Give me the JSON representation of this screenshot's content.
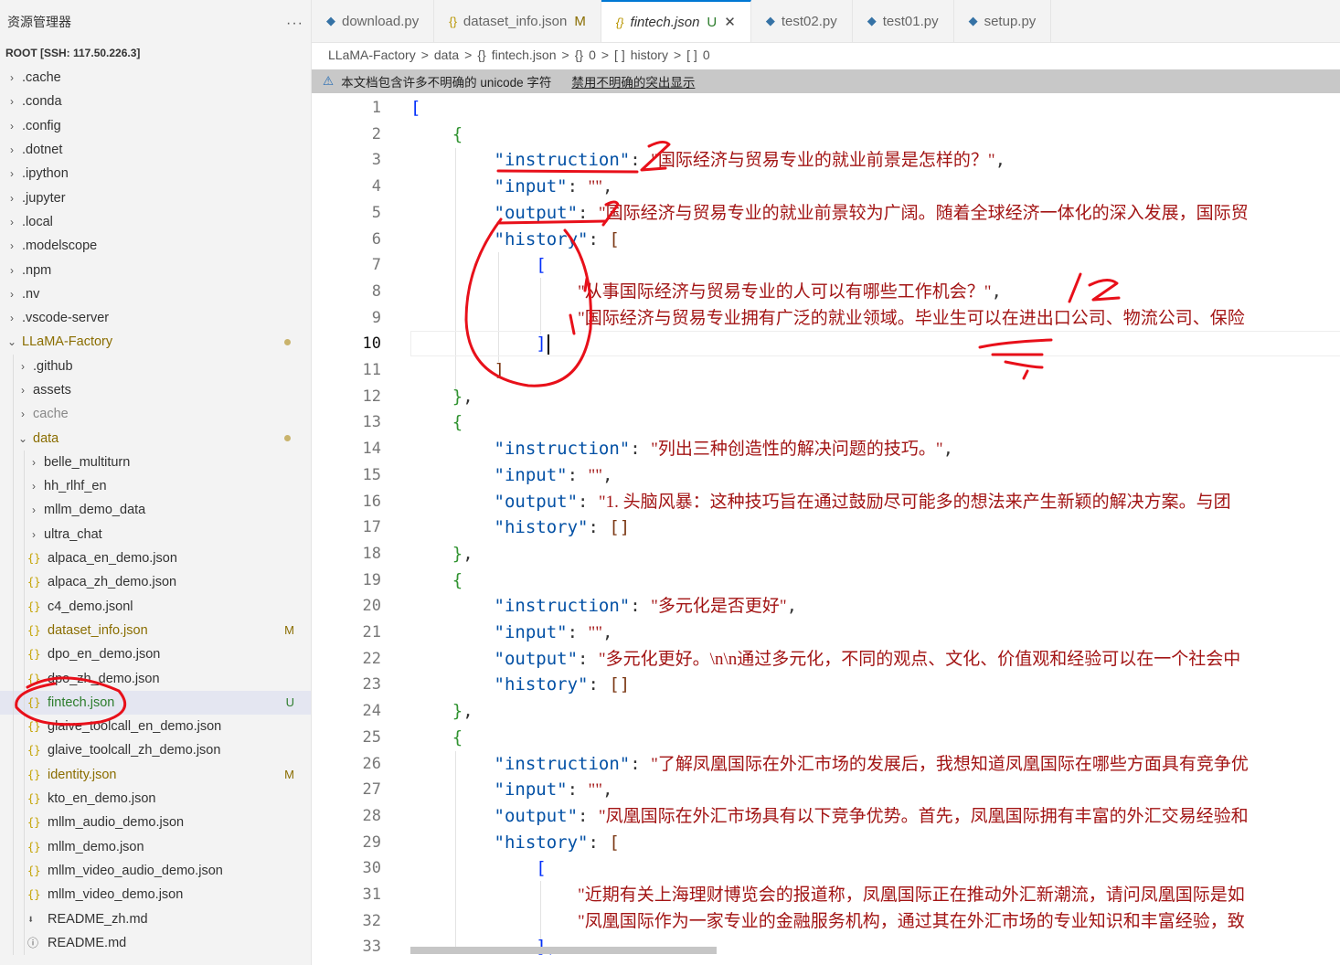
{
  "sidebar": {
    "title": "资源管理器",
    "more": "···",
    "root": "ROOT [SSH: 117.50.226.3]",
    "items": [
      {
        "label": ".cache",
        "kind": "folder",
        "depth": 0
      },
      {
        "label": ".conda",
        "kind": "folder",
        "depth": 0
      },
      {
        "label": ".config",
        "kind": "folder",
        "depth": 0
      },
      {
        "label": ".dotnet",
        "kind": "folder",
        "depth": 0
      },
      {
        "label": ".ipython",
        "kind": "folder",
        "depth": 0
      },
      {
        "label": ".jupyter",
        "kind": "folder",
        "depth": 0
      },
      {
        "label": ".local",
        "kind": "folder",
        "depth": 0
      },
      {
        "label": ".modelscope",
        "kind": "folder",
        "depth": 0
      },
      {
        "label": ".npm",
        "kind": "folder",
        "depth": 0
      },
      {
        "label": ".nv",
        "kind": "folder",
        "depth": 0
      },
      {
        "label": ".vscode-server",
        "kind": "folder",
        "depth": 0
      },
      {
        "label": "LLaMA-Factory",
        "kind": "folder-open",
        "depth": 0,
        "dot": true,
        "color": "#8a6d00"
      },
      {
        "label": ".github",
        "kind": "folder",
        "depth": 1
      },
      {
        "label": "assets",
        "kind": "folder",
        "depth": 1
      },
      {
        "label": "cache",
        "kind": "folder",
        "depth": 1,
        "muted": true
      },
      {
        "label": "data",
        "kind": "folder-open",
        "depth": 1,
        "dot": true,
        "color": "#8a6d00"
      },
      {
        "label": "belle_multiturn",
        "kind": "folder",
        "depth": 2
      },
      {
        "label": "hh_rlhf_en",
        "kind": "folder",
        "depth": 2
      },
      {
        "label": "mllm_demo_data",
        "kind": "folder",
        "depth": 2
      },
      {
        "label": "ultra_chat",
        "kind": "folder",
        "depth": 2
      },
      {
        "label": "alpaca_en_demo.json",
        "kind": "json",
        "depth": 2
      },
      {
        "label": "alpaca_zh_demo.json",
        "kind": "json",
        "depth": 2
      },
      {
        "label": "c4_demo.jsonl",
        "kind": "json",
        "depth": 2
      },
      {
        "label": "dataset_info.json",
        "kind": "json",
        "depth": 2,
        "badge": "M",
        "color": "#8a6d00"
      },
      {
        "label": "dpo_en_demo.json",
        "kind": "json",
        "depth": 2
      },
      {
        "label": "dpo_zh_demo.json",
        "kind": "json",
        "depth": 2
      },
      {
        "label": "fintech.json",
        "kind": "json",
        "depth": 2,
        "badge": "U",
        "selected": true,
        "color": "#2d7d2d"
      },
      {
        "label": "glaive_toolcall_en_demo.json",
        "kind": "json",
        "depth": 2
      },
      {
        "label": "glaive_toolcall_zh_demo.json",
        "kind": "json",
        "depth": 2
      },
      {
        "label": "identity.json",
        "kind": "json",
        "depth": 2,
        "badge": "M",
        "color": "#8a6d00"
      },
      {
        "label": "kto_en_demo.json",
        "kind": "json",
        "depth": 2
      },
      {
        "label": "mllm_audio_demo.json",
        "kind": "json",
        "depth": 2
      },
      {
        "label": "mllm_demo.json",
        "kind": "json",
        "depth": 2
      },
      {
        "label": "mllm_video_audio_demo.json",
        "kind": "json",
        "depth": 2
      },
      {
        "label": "mllm_video_demo.json",
        "kind": "json",
        "depth": 2
      },
      {
        "label": "README_zh.md",
        "kind": "md",
        "depth": 2
      },
      {
        "label": "README.md",
        "kind": "info",
        "depth": 2
      }
    ]
  },
  "tabs": [
    {
      "label": "download.py",
      "icon": "python-icon",
      "mod": ""
    },
    {
      "label": "dataset_info.json",
      "icon": "json-icon",
      "mod": "M"
    },
    {
      "label": "fintech.json",
      "icon": "json-icon",
      "mod": "U",
      "active": true,
      "close": "✕"
    },
    {
      "label": "test02.py",
      "icon": "python-icon",
      "mod": ""
    },
    {
      "label": "test01.py",
      "icon": "python-icon",
      "mod": ""
    },
    {
      "label": "setup.py",
      "icon": "python-icon",
      "mod": ""
    }
  ],
  "breadcrumb": [
    "LLaMA-Factory",
    ">",
    "data",
    ">",
    "{}",
    "fintech.json",
    ">",
    "{}",
    "0",
    ">",
    "[ ]",
    "history",
    ">",
    "[ ]",
    "0"
  ],
  "warning": {
    "text": "本文档包含许多不明确的 unicode 字符",
    "link": "禁用不明确的突出显示"
  },
  "editor": {
    "current_line": 10,
    "lines": [
      {
        "n": "1",
        "segs": [
          [
            "br",
            "["
          ]
        ]
      },
      {
        "n": "2",
        "segs": [
          [
            "sp",
            "    "
          ],
          [
            "br2",
            "{"
          ]
        ]
      },
      {
        "n": "3",
        "segs": [
          [
            "sp",
            "        "
          ],
          [
            "k",
            "\"instruction\""
          ],
          [
            "p",
            ": "
          ],
          [
            "s",
            "\"国际经济与贸易专业的就业前景是怎样的？\""
          ],
          [
            "p",
            ","
          ]
        ]
      },
      {
        "n": "4",
        "segs": [
          [
            "sp",
            "        "
          ],
          [
            "k",
            "\"input\""
          ],
          [
            "p",
            ": "
          ],
          [
            "s",
            "\"\""
          ],
          [
            "p",
            ","
          ]
        ]
      },
      {
        "n": "5",
        "segs": [
          [
            "sp",
            "        "
          ],
          [
            "k",
            "\"output\""
          ],
          [
            "p",
            ": "
          ],
          [
            "s",
            "\"国际经济与贸易专业的就业前景较为广阔。随着全球经济一体化的深入发展，国际贸"
          ]
        ]
      },
      {
        "n": "6",
        "segs": [
          [
            "sp",
            "        "
          ],
          [
            "k",
            "\"history\""
          ],
          [
            "p",
            ": "
          ],
          [
            "br3",
            "["
          ]
        ]
      },
      {
        "n": "7",
        "segs": [
          [
            "sp",
            "            "
          ],
          [
            "br",
            "["
          ]
        ]
      },
      {
        "n": "8",
        "segs": [
          [
            "sp",
            "                "
          ],
          [
            "s",
            "\"从事国际经济与贸易专业的人可以有哪些工作机会？\""
          ],
          [
            "p",
            ","
          ]
        ]
      },
      {
        "n": "9",
        "segs": [
          [
            "sp",
            "                "
          ],
          [
            "s",
            "\"国际经济与贸易专业拥有广泛的就业领域。毕业生可以在进出口公司、物流公司、保险"
          ]
        ]
      },
      {
        "n": "10",
        "segs": [
          [
            "sp",
            "            "
          ],
          [
            "br",
            "]"
          ],
          [
            "caret",
            ""
          ]
        ]
      },
      {
        "n": "11",
        "segs": [
          [
            "sp",
            "        "
          ],
          [
            "br3",
            "]"
          ]
        ]
      },
      {
        "n": "12",
        "segs": [
          [
            "sp",
            "    "
          ],
          [
            "br2",
            "}"
          ],
          [
            "p",
            ","
          ]
        ]
      },
      {
        "n": "13",
        "segs": [
          [
            "sp",
            "    "
          ],
          [
            "br2",
            "{"
          ]
        ]
      },
      {
        "n": "14",
        "segs": [
          [
            "sp",
            "        "
          ],
          [
            "k",
            "\"instruction\""
          ],
          [
            "p",
            ": "
          ],
          [
            "s",
            "\"列出三种创造性的解决问题的技巧。\""
          ],
          [
            "p",
            ","
          ]
        ]
      },
      {
        "n": "15",
        "segs": [
          [
            "sp",
            "        "
          ],
          [
            "k",
            "\"input\""
          ],
          [
            "p",
            ": "
          ],
          [
            "s",
            "\"\""
          ],
          [
            "p",
            ","
          ]
        ]
      },
      {
        "n": "16",
        "segs": [
          [
            "sp",
            "        "
          ],
          [
            "k",
            "\"output\""
          ],
          [
            "p",
            ": "
          ],
          [
            "s",
            "\"1. 头脑风暴：这种技巧旨在通过鼓励尽可能多的想法来产生新颖的解决方案。与团"
          ]
        ]
      },
      {
        "n": "17",
        "segs": [
          [
            "sp",
            "        "
          ],
          [
            "k",
            "\"history\""
          ],
          [
            "p",
            ": "
          ],
          [
            "br3",
            "[]"
          ]
        ]
      },
      {
        "n": "18",
        "segs": [
          [
            "sp",
            "    "
          ],
          [
            "br2",
            "}"
          ],
          [
            "p",
            ","
          ]
        ]
      },
      {
        "n": "19",
        "segs": [
          [
            "sp",
            "    "
          ],
          [
            "br2",
            "{"
          ]
        ]
      },
      {
        "n": "20",
        "segs": [
          [
            "sp",
            "        "
          ],
          [
            "k",
            "\"instruction\""
          ],
          [
            "p",
            ": "
          ],
          [
            "s",
            "\"多元化是否更好\""
          ],
          [
            "p",
            ","
          ]
        ]
      },
      {
        "n": "21",
        "segs": [
          [
            "sp",
            "        "
          ],
          [
            "k",
            "\"input\""
          ],
          [
            "p",
            ": "
          ],
          [
            "s",
            "\"\""
          ],
          [
            "p",
            ","
          ]
        ]
      },
      {
        "n": "22",
        "segs": [
          [
            "sp",
            "        "
          ],
          [
            "k",
            "\"output\""
          ],
          [
            "p",
            ": "
          ],
          [
            "s",
            "\"多元化更好。\\n\\n通过多元化，不同的观点、文化、价值观和经验可以在一个社会中"
          ]
        ]
      },
      {
        "n": "23",
        "segs": [
          [
            "sp",
            "        "
          ],
          [
            "k",
            "\"history\""
          ],
          [
            "p",
            ": "
          ],
          [
            "br3",
            "[]"
          ]
        ]
      },
      {
        "n": "24",
        "segs": [
          [
            "sp",
            "    "
          ],
          [
            "br2",
            "}"
          ],
          [
            "p",
            ","
          ]
        ]
      },
      {
        "n": "25",
        "segs": [
          [
            "sp",
            "    "
          ],
          [
            "br2",
            "{"
          ]
        ]
      },
      {
        "n": "26",
        "segs": [
          [
            "sp",
            "        "
          ],
          [
            "k",
            "\"instruction\""
          ],
          [
            "p",
            ": "
          ],
          [
            "s",
            "\"了解凤凰国际在外汇市场的发展后，我想知道凤凰国际在哪些方面具有竞争优"
          ]
        ]
      },
      {
        "n": "27",
        "segs": [
          [
            "sp",
            "        "
          ],
          [
            "k",
            "\"input\""
          ],
          [
            "p",
            ": "
          ],
          [
            "s",
            "\"\""
          ],
          [
            "p",
            ","
          ]
        ]
      },
      {
        "n": "28",
        "segs": [
          [
            "sp",
            "        "
          ],
          [
            "k",
            "\"output\""
          ],
          [
            "p",
            ": "
          ],
          [
            "s",
            "\"凤凰国际在外汇市场具有以下竞争优势。首先，凤凰国际拥有丰富的外汇交易经验和"
          ]
        ]
      },
      {
        "n": "29",
        "segs": [
          [
            "sp",
            "        "
          ],
          [
            "k",
            "\"history\""
          ],
          [
            "p",
            ": "
          ],
          [
            "br3",
            "["
          ]
        ]
      },
      {
        "n": "30",
        "segs": [
          [
            "sp",
            "            "
          ],
          [
            "br",
            "["
          ]
        ]
      },
      {
        "n": "31",
        "segs": [
          [
            "sp",
            "                "
          ],
          [
            "s",
            "\"近期有关上海理财博览会的报道称，凤凰国际正在推动外汇新潮流，请问凤凰国际是如"
          ]
        ]
      },
      {
        "n": "32",
        "segs": [
          [
            "sp",
            "                "
          ],
          [
            "s",
            "\"凤凰国际作为一家专业的金融服务机构，通过其在外汇市场的专业知识和丰富经验，致"
          ]
        ]
      },
      {
        "n": "33",
        "segs": [
          [
            "sp",
            "            "
          ],
          [
            "br",
            "],"
          ]
        ]
      }
    ]
  },
  "colors": {
    "accent": "#0078d4",
    "annotation": "#e8101a",
    "json_key": "#0451a5",
    "json_string": "#a31515"
  }
}
